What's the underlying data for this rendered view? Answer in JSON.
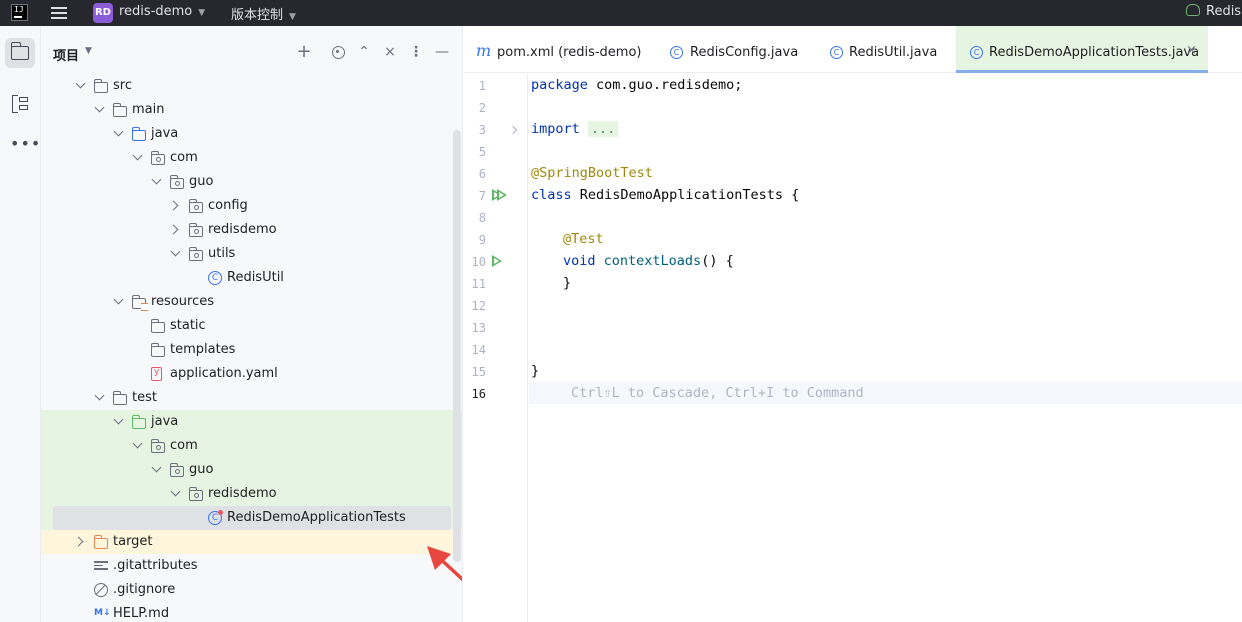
{
  "titlebar": {
    "logo": "IJ",
    "project_badge": "RD",
    "project_name": "redis-demo",
    "vcs_label": "版本控制",
    "run_config": "Redis"
  },
  "toolstrip": {
    "items": [
      "project-tool",
      "structure-tool",
      "more-tools"
    ]
  },
  "project_panel": {
    "title": "项目",
    "tree": [
      {
        "label": "src",
        "depth": 0,
        "expanded": true,
        "icon": "folder"
      },
      {
        "label": "main",
        "depth": 1,
        "expanded": true,
        "icon": "folder"
      },
      {
        "label": "java",
        "depth": 2,
        "expanded": true,
        "icon": "folder-blue"
      },
      {
        "label": "com",
        "depth": 3,
        "expanded": true,
        "icon": "package"
      },
      {
        "label": "guo",
        "depth": 4,
        "expanded": true,
        "icon": "package"
      },
      {
        "label": "config",
        "depth": 5,
        "expanded": false,
        "icon": "package"
      },
      {
        "label": "redisdemo",
        "depth": 5,
        "expanded": false,
        "icon": "package"
      },
      {
        "label": "utils",
        "depth": 5,
        "expanded": true,
        "icon": "package"
      },
      {
        "label": "RedisUtil",
        "depth": 6,
        "icon": "class"
      },
      {
        "label": "resources",
        "depth": 2,
        "expanded": true,
        "icon": "resources"
      },
      {
        "label": "static",
        "depth": 3,
        "icon": "folder"
      },
      {
        "label": "templates",
        "depth": 3,
        "icon": "folder"
      },
      {
        "label": "application.yaml",
        "depth": 3,
        "icon": "yaml"
      },
      {
        "label": "test",
        "depth": 1,
        "expanded": true,
        "icon": "folder"
      },
      {
        "label": "java",
        "depth": 2,
        "expanded": true,
        "icon": "folder-green",
        "highlight": "green"
      },
      {
        "label": "com",
        "depth": 3,
        "expanded": true,
        "icon": "package",
        "highlight": "green"
      },
      {
        "label": "guo",
        "depth": 4,
        "expanded": true,
        "icon": "package",
        "highlight": "green"
      },
      {
        "label": "redisdemo",
        "depth": 5,
        "expanded": true,
        "icon": "package",
        "highlight": "green"
      },
      {
        "label": "RedisDemoApplicationTests",
        "depth": 6,
        "icon": "testclass",
        "highlight": "selected"
      },
      {
        "label": "target",
        "depth": 0,
        "expanded": false,
        "icon": "folder-orange",
        "highlight": "yellow"
      },
      {
        "label": ".gitattributes",
        "depth": 0,
        "icon": "lines"
      },
      {
        "label": ".gitignore",
        "depth": 0,
        "icon": "ignore"
      },
      {
        "label": "HELP.md",
        "depth": 0,
        "icon": "md"
      }
    ],
    "md_icon_text": "M↓"
  },
  "tabs": [
    {
      "label": "pom.xml (redis-demo)",
      "icon": "maven-icon",
      "icon_text": "m"
    },
    {
      "label": "RedisConfig.java",
      "icon": "class-icon",
      "icon_text": "C"
    },
    {
      "label": "RedisUtil.java",
      "icon": "class-icon",
      "icon_text": "C"
    },
    {
      "label": "RedisDemoApplicationTests.java",
      "icon": "testclass-icon",
      "icon_text": "C",
      "active": true
    }
  ],
  "tab_close": "×",
  "editor": {
    "line_numbers": [
      "1",
      "2",
      "3",
      "5",
      "6",
      "7",
      "8",
      "9",
      "10",
      "11",
      "12",
      "13",
      "14",
      "15",
      "16"
    ],
    "current_line": "16",
    "code": {
      "l1_kw": "package",
      "l1_rest": " com.guo.redisdemo;",
      "l3_kw": "import",
      "l3_fold": "...",
      "l6_ann": "@SpringBootTest",
      "l7_kw": "class",
      "l7_rest": " RedisDemoApplicationTests {",
      "l9_ann": "@Test",
      "l10_kw": "void",
      "l10_fn": "contextLoads",
      "l10_rest": "() {",
      "l11": "}",
      "l15": "}",
      "l16_hint": "Ctrl⇧L to Cascade, Ctrl+I to Command"
    }
  },
  "colors": {
    "accent": "#3574f0",
    "test_green": "#e6f5e2",
    "excluded_yellow": "#fdf6dc",
    "annotation_arrow": "#e8473f"
  }
}
